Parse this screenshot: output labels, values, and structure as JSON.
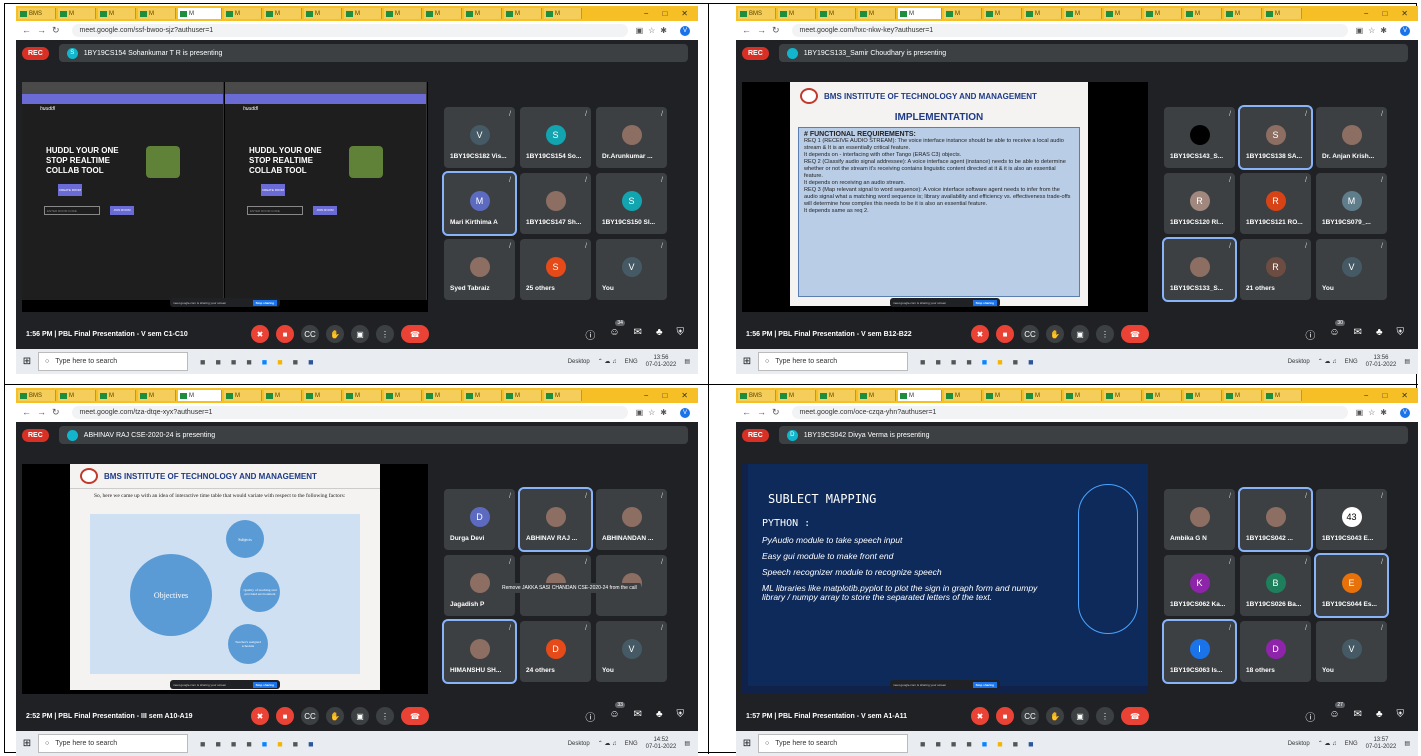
{
  "common": {
    "search_placeholder": "Type here to search",
    "desktop_label": "Desktop",
    "lang": "ENG",
    "rec": "REC",
    "tab_label": "M",
    "active_tab": "BMS"
  },
  "panels": [
    {
      "url": "meet.google.com/ssf-bwoo-sjz?authuser=1",
      "presenter": "1BY19CS154 Sohankumar T R is presenting",
      "presenter_initial": "S",
      "meeting": "1:56 PM  |  PBL Final Presentation - V sem C1-C10",
      "time": "13:56",
      "date": "07-01-2022",
      "people_count": "34",
      "stage": {
        "hero_line1": "HUDDL YOUR ONE",
        "hero_line2": "STOP REALTIME",
        "hero_line3": "COLLAB TOOL",
        "brand": "huuddl",
        "create_btn": "CREATE ROOM",
        "join_btn": "JOIN ROOM",
        "input_placeholder": "ENTER ROOM CODE"
      },
      "tiles": [
        {
          "name": "1BY19CS182 Vis...",
          "initial": "V",
          "color": "#455a64"
        },
        {
          "name": "1BY19CS154 So...",
          "initial": "S",
          "color": "#12a4af"
        },
        {
          "name": "Dr.Arunkumar ...",
          "initial": "",
          "color": "#6d4c41"
        },
        {
          "name": "Mari Kirthima A",
          "initial": "M",
          "color": "#5c6bc0"
        },
        {
          "name": "1BY19CS147 Sh...",
          "initial": "",
          "color": "#8d6e63"
        },
        {
          "name": "1BY19CS150 Sl...",
          "initial": "S",
          "color": "#12a4af"
        },
        {
          "name": "Syed Tabraiz",
          "initial": "",
          "color": "#3c4043"
        },
        {
          "name": "25 others",
          "initial": "S",
          "color": "#e64a19"
        },
        {
          "name": "You",
          "initial": "V",
          "color": "#455a64"
        }
      ]
    },
    {
      "url": "meet.google.com/hxc-nkw-key?authuser=1",
      "presenter": "1BY19CS133_Samir Choudhary is presenting",
      "presenter_initial": "",
      "meeting": "1:56 PM  |  PBL Final Presentation - V sem B12-B22",
      "time": "13:56",
      "date": "07-01-2022",
      "people_count": "30",
      "slide": {
        "institute": "BMS INSTITUTE OF TECHNOLOGY AND MANAGEMENT",
        "title": "IMPLEMENTATION",
        "lines": [
          "# FUNCTIONAL REQUIREMENTS:",
          "REQ 1 (RECEIVE AUDIO STREAM): The voice interface instance should be able to receive a local audio stream & It is an essentially critical feature.",
          "It depends on - interfacing with other Tango (ERAS C3) objects.",
          "REQ 2 (Classify audio signal addressee): A voice interface agent (instance) needs to be able to determine whether or not the stream it's receiving contains linguistic content directed at it & it is also an essential feature.",
          "It depends on receiving an audio stream.",
          "REQ 3 (Map relevant signal to word sequence): A voice interface software agent needs to infer from the audio signal what a matching word sequence is; library availability and efficiency vs. effectiveness trade-offs will determine how complex this needs to be  it is also an essential feature.",
          "It depends same as req 2."
        ]
      },
      "tiles": [
        {
          "name": "1BY19CS143_S...",
          "initial": "",
          "color": "#000000"
        },
        {
          "name": "1BY19CS138 SA...",
          "initial": "S",
          "color": "#8d6e63"
        },
        {
          "name": "Dr. Anjan Krish...",
          "initial": "",
          "color": "#3c4043"
        },
        {
          "name": "1BY19CS120 RI...",
          "initial": "R",
          "color": "#a1887f"
        },
        {
          "name": "1BY19CS121 RO...",
          "initial": "R",
          "color": "#d84315"
        },
        {
          "name": "1BY19CS079_...",
          "initial": "M",
          "color": "#607d8b"
        },
        {
          "name": "1BY19CS133_S...",
          "initial": "",
          "color": "#3c4043"
        },
        {
          "name": "21 others",
          "initial": "R",
          "color": "#6d4c41"
        },
        {
          "name": "You",
          "initial": "V",
          "color": "#455a64"
        }
      ]
    },
    {
      "url": "meet.google.com/tza-dtqe-xyx?authuser=1",
      "presenter": "ABHINAV RAJ CSE-2020-24 is presenting",
      "presenter_initial": "",
      "meeting": "2:52 PM  |  PBL Final Presentation - III sem A10-A19",
      "time": "14:52",
      "date": "07-01-2022",
      "people_count": "33",
      "slide": {
        "institute": "BMS INSTITUTE OF TECHNOLOGY AND MANAGEMENT",
        "intro": "So, here we came up with an idea of interactive time table that would variate with respect to the following factors:",
        "center": "Objectives",
        "n1": "Subjects",
        "n2": "Quality of teaching and provided environment",
        "n3": "Teacher's assigned schedule"
      },
      "remove_tooltip": "Remove JAKKA SASI CHANDAN CSE-2020-24 from the call",
      "tiles": [
        {
          "name": "Durga Devi",
          "initial": "D",
          "color": "#5c6bc0"
        },
        {
          "name": "ABHINAV RAJ ...",
          "initial": "",
          "color": "#3c4043"
        },
        {
          "name": "ABHINANDAN ...",
          "initial": "",
          "color": "#3c4043"
        },
        {
          "name": "Jagadish P",
          "initial": "",
          "color": "#3c4043"
        },
        {
          "name": "",
          "initial": "",
          "color": "#3c4043"
        },
        {
          "name": "",
          "initial": "",
          "color": "#3c4043"
        },
        {
          "name": "HIMANSHU SH...",
          "initial": "",
          "color": "#3c4043"
        },
        {
          "name": "24 others",
          "initial": "D",
          "color": "#e64a19"
        },
        {
          "name": "You",
          "initial": "V",
          "color": "#455a64"
        }
      ]
    },
    {
      "url": "meet.google.com/oce-czqa-yhn?authuser=1",
      "presenter": "1BY19CS042 Divya Verma is presenting",
      "presenter_initial": "D",
      "meeting": "1:57 PM  |  PBL Final Presentation - V sem A1-A11",
      "time": "13:57",
      "date": "07-01-2022",
      "people_count": "27",
      "slide": {
        "title": "SUBLECT MAPPING",
        "subtitle": "PYTHON :",
        "bullets": [
          "PyAudio module to take speech input",
          "Easy gui module to make front end",
          "Speech recognizer module to recognize speech",
          "ML libraries like matplotib.pyplot to plot the sign in graph form and numpy library / numpy array to store the separated  letters of the text."
        ]
      },
      "tiles": [
        {
          "name": "Ambika G N",
          "initial": "",
          "color": "#3c4043"
        },
        {
          "name": "1BY19CS042 ...",
          "initial": "",
          "color": "#7a8a6a"
        },
        {
          "name": "1BY19CS043 E...",
          "initial": "43",
          "color": "#ffffff"
        },
        {
          "name": "1BY19CS062 Ka...",
          "initial": "K",
          "color": "#8e24aa"
        },
        {
          "name": "1BY19CS026 Ba...",
          "initial": "B",
          "color": "#1e7f5c"
        },
        {
          "name": "1BY19CS044 Es...",
          "initial": "E",
          "color": "#e8710a"
        },
        {
          "name": "1BY19CS063 Is...",
          "initial": "I",
          "color": "#1a73e8"
        },
        {
          "name": "18 others",
          "initial": "D",
          "color": "#8e24aa"
        },
        {
          "name": "You",
          "initial": "V",
          "color": "#455a64"
        }
      ]
    }
  ]
}
